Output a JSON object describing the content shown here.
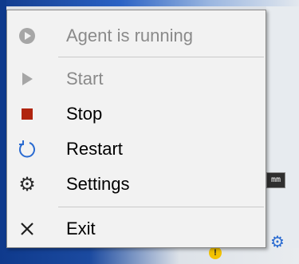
{
  "menu": {
    "items": [
      {
        "label": "Agent is running",
        "icon": "circle-play-icon",
        "disabled": true
      },
      {
        "label": "Start",
        "icon": "play-icon",
        "disabled": true
      },
      {
        "label": "Stop",
        "icon": "stop-icon",
        "disabled": false
      },
      {
        "label": "Restart",
        "icon": "restart-icon",
        "disabled": false
      },
      {
        "label": "Settings",
        "icon": "gear-icon",
        "disabled": false
      },
      {
        "label": "Exit",
        "icon": "close-icon",
        "disabled": false
      }
    ]
  },
  "tray": {
    "mm_label": "mm",
    "warn_label": "!"
  },
  "colors": {
    "stop": "#b0250f",
    "restart": "#2a6bd1",
    "disabled_text": "#8a8a8a",
    "disabled_icon": "#a6a6a6"
  }
}
